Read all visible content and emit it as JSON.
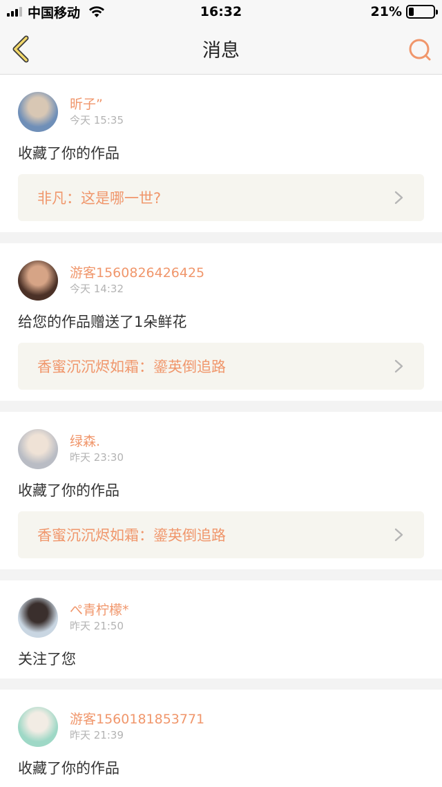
{
  "status_bar": {
    "carrier": "中国移动",
    "time": "16:32",
    "battery_percent": "21%",
    "battery_level": 0.21
  },
  "nav": {
    "title": "消息",
    "back_icon": "chevron-left-icon",
    "search_icon": "search-icon",
    "accent_color": "#f0966b"
  },
  "messages": [
    {
      "username": "昕子”",
      "time": "今天 15:35",
      "action": "收藏了你的作品",
      "ref": "非凡：这是哪一世?",
      "avatar_colors": [
        "#6f8fb8",
        "#d8c7b4"
      ]
    },
    {
      "username": "游客1560826426425",
      "time": "今天 14:32",
      "action": "给您的作品赠送了1朵鲜花",
      "ref": "香蜜沉沉烬如霜：鎏英倒追路",
      "avatar_colors": [
        "#4b3127",
        "#d6a486"
      ]
    },
    {
      "username": "绿森.",
      "time": "昨天 23:30",
      "action": "收藏了你的作品",
      "ref": "香蜜沉沉烬如霜：鎏英倒追路",
      "avatar_colors": [
        "#b9bcc4",
        "#efe2d6"
      ]
    },
    {
      "username": "ぺ青柠檬*",
      "time": "昨天 21:50",
      "action": "关注了您",
      "ref": null,
      "avatar_colors": [
        "#c9d6e2",
        "#3a2f2d"
      ]
    },
    {
      "username": "游客1560181853771",
      "time": "昨天 21:39",
      "action": "收藏了你的作品",
      "ref": null,
      "avatar_colors": [
        "#9ed8c6",
        "#f2ece4"
      ]
    }
  ]
}
